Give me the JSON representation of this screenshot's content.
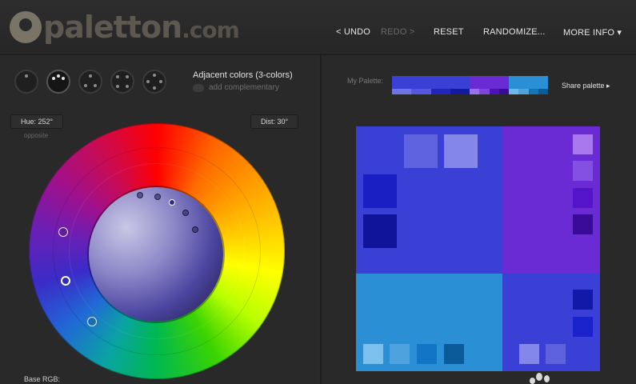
{
  "header": {
    "logo": "paletton",
    "logo_tld": ".com",
    "nav": [
      {
        "label": "< UNDO",
        "enabled": true
      },
      {
        "label": "REDO >",
        "enabled": false
      },
      {
        "label": "RESET",
        "enabled": true
      },
      {
        "label": "RANDOMIZE...",
        "enabled": true
      },
      {
        "label": "MORE INFO ▾",
        "enabled": true
      }
    ]
  },
  "scheme": {
    "modes": [
      "mono-icon",
      "adjacent-icon",
      "triad-icon",
      "tetrad-icon",
      "free-style-icon"
    ],
    "active_mode": 1,
    "title": "Adjacent colors (3-colors)",
    "add_complementary": "add complementary"
  },
  "wheel": {
    "hue_label": "Hue: 252°",
    "dist_label": "Dist: 30°",
    "opposite": "opposite",
    "base_rgb": "Base RGB:"
  },
  "palette": {
    "label": "My Palette:",
    "share": "Share palette ▸",
    "strip": [
      {
        "main": "#3a3fd6",
        "subs": [
          "#6f73e6",
          "#5558dc",
          "#2125b8",
          "#1518a0"
        ],
        "width": 97
      },
      {
        "main": "#6b2bd4",
        "subs": [
          "#9c6ee8",
          "#7e44dc",
          "#4e13b8",
          "#3a0a98"
        ],
        "width": 49
      },
      {
        "main": "#2a8fd4",
        "subs": [
          "#6fb5e8",
          "#4ea2de",
          "#1574b8",
          "#0c5c98"
        ],
        "width": 49
      }
    ]
  },
  "preview": {
    "primary": "#3a3fd6",
    "secondary1": "#6b2bd4",
    "secondary2": "#2a8fd4",
    "primary_br": "#3a3fd6",
    "primary_shades": [
      "#5f63e0",
      "#8587e8",
      "#1a1fc4",
      "#10149a"
    ],
    "secondary1_shades": [
      "#a978ee",
      "#8450e4",
      "#5414c8",
      "#3a0a98"
    ],
    "secondary2_shades": [
      "#7cc0ee",
      "#4ea2de",
      "#1174c4",
      "#0b5a9a"
    ],
    "primary_br_shades": [
      "#1218a8",
      "#1a22cc",
      "#8487ea",
      "#5e62de"
    ]
  }
}
